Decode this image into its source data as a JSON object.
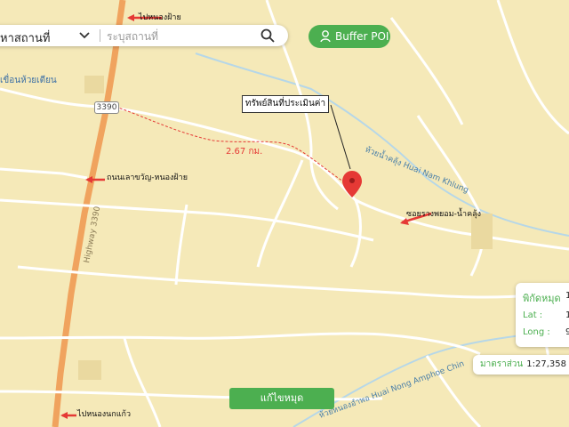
{
  "search": {
    "place_label": "หาสถานที่",
    "placeholder": "ระบุสถานที่"
  },
  "buffer_button": {
    "label": "Buffer POI"
  },
  "callout": {
    "text": "ทรัพย์สินที่ประเมินค่า"
  },
  "distance_label": "2.67 กม.",
  "highway_shield": "3390",
  "road_labels": {
    "top": "ไปหนองฝ้าย",
    "left_mid": "ถนนเลาขวัญ-หนองฝ้าย",
    "right_mid": "ซอยรางพยอม-น้ำคลุ้ง",
    "bottom": "ไปหนองนกแก้ว"
  },
  "map_labels": {
    "dam": "เขื่อนห้วยเตียน",
    "highway": "Highway 3390",
    "stream_top": "ห้วยน้ำคลุ้ง Huai Nam Khlung",
    "stream_bottom": "ห้วยหนองอำพอ Huai Nong Amphoe Chin"
  },
  "coord_panel": {
    "title": "พิกัดหมุด",
    "title_value": "1",
    "lat_label": "Lat :",
    "lat_value": "1",
    "long_label": "Long :",
    "long_value": "9"
  },
  "scale": {
    "label": "มาตราส่วน",
    "value": "1:27,358"
  },
  "edit_pin_button": {
    "label": "แก้ไขหมุด"
  },
  "colors": {
    "map_bg": "#f5e9b8",
    "road": "#ffffff",
    "accent": "#4caf50",
    "pin": "#e53935",
    "arrow": "#e53935"
  }
}
